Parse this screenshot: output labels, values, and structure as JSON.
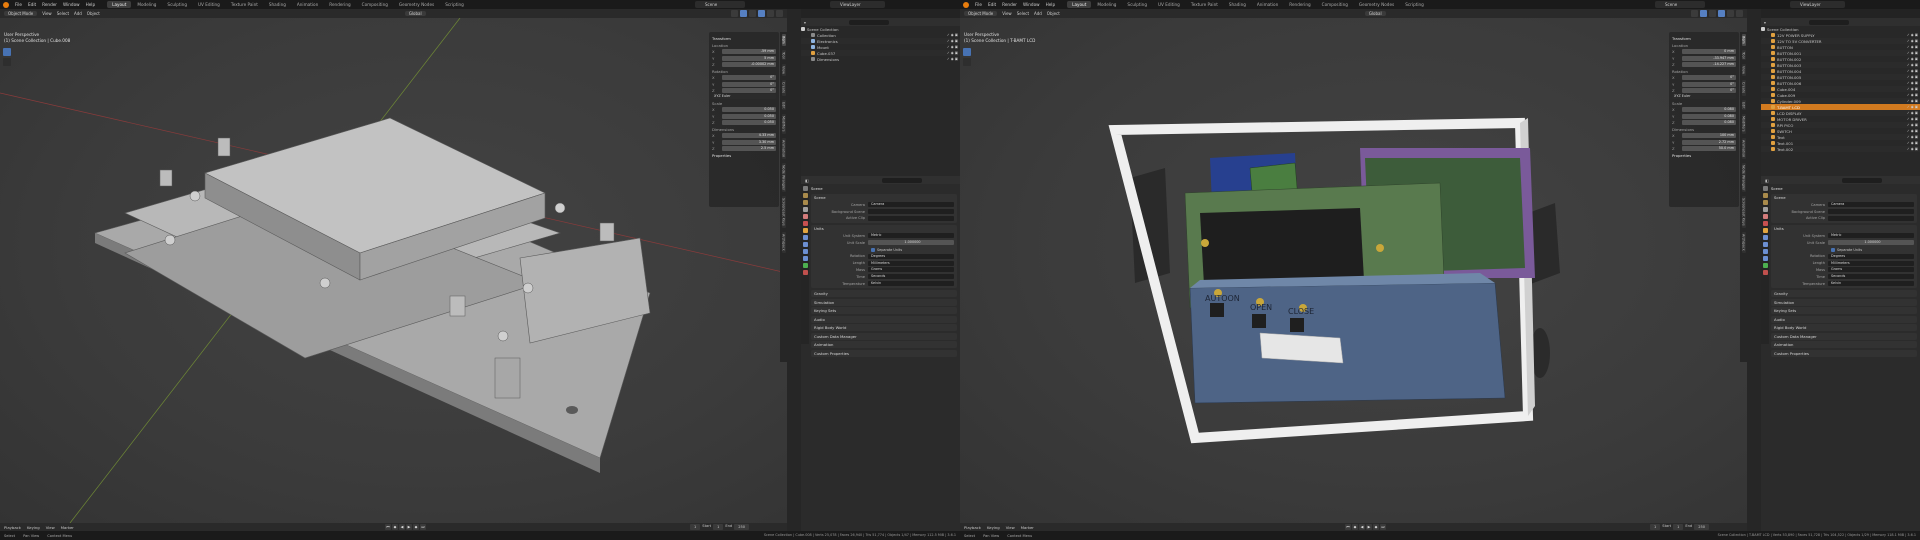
{
  "topbar": {
    "menus": [
      "File",
      "Edit",
      "Render",
      "Window",
      "Help"
    ],
    "workspaces": [
      "Layout",
      "Modeling",
      "Sculpting",
      "UV Editing",
      "Texture Paint",
      "Shading",
      "Animation",
      "Rendering",
      "Compositing",
      "Geometry Nodes",
      "Scripting"
    ],
    "active_workspace": "Layout",
    "scene": "Scene",
    "view_layer": "ViewLayer"
  },
  "viewport_header": {
    "mode": "Object Mode",
    "view": "View",
    "select": "Select",
    "add": "Add",
    "object": "Object",
    "transform": "Global",
    "options": "Options"
  },
  "left": {
    "vp_title": "User Perspective",
    "vp_context": "(1) Scene Collection | Cube.008",
    "npanel": {
      "transform": "Transform",
      "location_label": "Location",
      "location": [
        "-59 mm",
        "5 mm",
        "-0.00002 mm"
      ],
      "rotation_label": "Rotation",
      "rotation": [
        "0°",
        "0°",
        "0°"
      ],
      "rotation_mode": "XYZ Euler",
      "scale_label": "Scale",
      "scale": [
        "0.050",
        "0.050",
        "0.050"
      ],
      "dimensions_label": "Dimensions",
      "dimensions": [
        "4.33 mm",
        "3.30 mm",
        "2.5 mm"
      ],
      "properties": "Properties"
    },
    "outliner": {
      "title": "Scene Collection",
      "rows": [
        {
          "name": "Collection",
          "color": "#8a8a8a",
          "cls": ""
        },
        {
          "name": "Electronics",
          "color": "#8fb4e0",
          "cls": "alt"
        },
        {
          "name": "Mount",
          "color": "#8fb4e0",
          "cls": ""
        },
        {
          "name": "Cube.037",
          "color": "#e0a040",
          "cls": "alt"
        },
        {
          "name": "Dimensions",
          "color": "#8a8a8a",
          "cls": ""
        }
      ]
    },
    "timeline": {
      "playback": "Playback",
      "keying": "Keying",
      "view": "View",
      "marker": "Marker",
      "current": "1",
      "start_label": "Start",
      "start": "1",
      "end_label": "End",
      "end": "250"
    },
    "status": {
      "select": "Select",
      "pan": "Pan View",
      "menu": "Context Menu",
      "stats": "Scene Collection | Cube.008 | Verts 25,078 | Faces 26,940 | Tris 51,774 | Objects 1/47 | Memory 112.5 MiB | 3.6.1"
    }
  },
  "right": {
    "vp_title": "User Perspective",
    "vp_context": "(1) Scene Collection | T-BAMT LCD",
    "labels": {
      "autoon": "AUTOON",
      "open": "OPEN",
      "close": "CLOSE"
    },
    "npanel": {
      "transform": "Transform",
      "location_label": "Location",
      "location": [
        "0 mm",
        "-33.947 mm",
        "-14.227 mm"
      ],
      "rotation_label": "Rotation",
      "rotation": [
        "0°",
        "0°",
        "0°"
      ],
      "rotation_mode": "XYZ Euler",
      "scale_label": "Scale",
      "scale": [
        "0.080",
        "0.080",
        "0.080"
      ],
      "dimensions_label": "Dimensions",
      "dimensions": [
        "100 mm",
        "2.72 mm",
        "50.0 mm"
      ],
      "properties": "Properties"
    },
    "outliner": {
      "title": "Scene Collection",
      "rows": [
        {
          "name": "12V POWER SUPPLY",
          "color": "#e0a040",
          "cls": ""
        },
        {
          "name": "12V TO 5V CONVERTER",
          "color": "#e0a040",
          "cls": "alt"
        },
        {
          "name": "BUTTON",
          "color": "#e0a040",
          "cls": ""
        },
        {
          "name": "BUTTON.001",
          "color": "#e0a040",
          "cls": "alt"
        },
        {
          "name": "BUTTON.002",
          "color": "#e0a040",
          "cls": ""
        },
        {
          "name": "BUTTON.003",
          "color": "#e0a040",
          "cls": "alt"
        },
        {
          "name": "BUTTON.004",
          "color": "#e0a040",
          "cls": ""
        },
        {
          "name": "BUTTON.005",
          "color": "#e0a040",
          "cls": "alt"
        },
        {
          "name": "BUTTON.006",
          "color": "#e0a040",
          "cls": ""
        },
        {
          "name": "Cube.004",
          "color": "#e0a040",
          "cls": "alt"
        },
        {
          "name": "Cube.009",
          "color": "#e0a040",
          "cls": ""
        },
        {
          "name": "Cylinder.009",
          "color": "#e0a040",
          "cls": "alt"
        },
        {
          "name": "T-BAMT LCD",
          "color": "#e0a040",
          "cls": "sel"
        },
        {
          "name": "LCD DISPLAY",
          "color": "#e0a040",
          "cls": "alt"
        },
        {
          "name": "MOTOR DRIVER",
          "color": "#e0a040",
          "cls": ""
        },
        {
          "name": "RPI PICO",
          "color": "#e0a040",
          "cls": "alt"
        },
        {
          "name": "SWITCH",
          "color": "#e0a040",
          "cls": ""
        },
        {
          "name": "Text",
          "color": "#e0a040",
          "cls": "alt"
        },
        {
          "name": "Text.001",
          "color": "#e0a040",
          "cls": ""
        },
        {
          "name": "Text.002",
          "color": "#e0a040",
          "cls": "alt"
        }
      ]
    },
    "timeline": {
      "playback": "Playback",
      "keying": "Keying",
      "view": "View",
      "marker": "Marker",
      "current": "1",
      "start_label": "Start",
      "start": "1",
      "end_label": "End",
      "end": "250"
    },
    "status": {
      "select": "Select",
      "pan": "Pan View",
      "menu": "Context Menu",
      "stats": "Scene Collection | T-BAMT LCD | Verts 53,890 | Faces 51,728 | Tris 104,522 | Objects 1/29 | Memory 118.1 MiB | 3.6.1"
    }
  },
  "properties": {
    "scene": "Scene",
    "scene_panel": "Scene",
    "camera_label": "Camera",
    "camera": "Camera",
    "bg_label": "Background Scene",
    "bg": "",
    "clip_label": "Active Clip",
    "clip": "",
    "units_panel": "Units",
    "unit_system_label": "Unit System",
    "unit_system": "Metric",
    "unit_scale_label": "Unit Scale",
    "unit_scale": "1.000000",
    "separate_units": "Separate Units",
    "rotation_label": "Rotation",
    "rotation": "Degrees",
    "length_label": "Length",
    "length": "Millimeters",
    "mass_label": "Mass",
    "mass": "Grams",
    "time_label": "Time",
    "time": "Seconds",
    "temp_label": "Temperature",
    "temp": "Kelvin",
    "collapsed": [
      "Gravity",
      "Simulation",
      "Keying Sets",
      "Audio",
      "Rigid Body World",
      "Custom Data Manager",
      "Animation",
      "Custom Properties"
    ]
  },
  "side_tabs": [
    "Item",
    "Tool",
    "View",
    "Create",
    "Edit",
    "Modifiers",
    "Animation",
    "Node Wrangler",
    "Screencast Keys",
    "Archipack"
  ]
}
